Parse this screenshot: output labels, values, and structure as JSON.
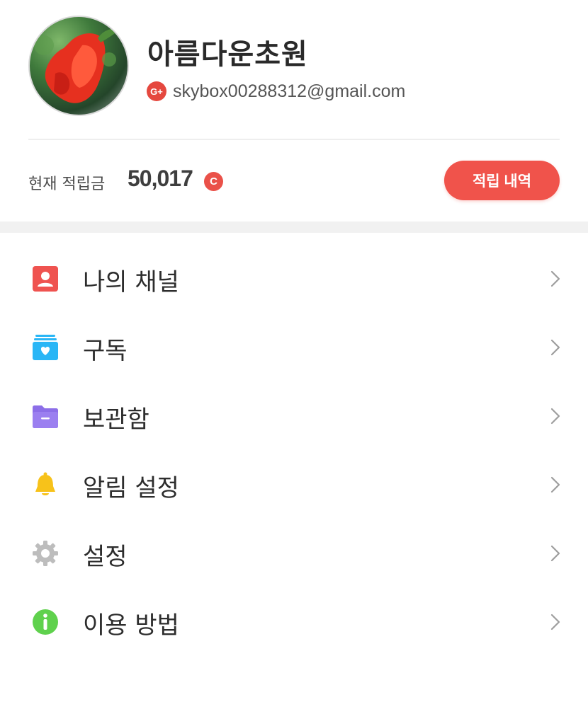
{
  "profile": {
    "name": "아름다운초원",
    "provider_badge": "G+",
    "email": "skybox00288312@gmail.com"
  },
  "points": {
    "label": "현재 적립금",
    "value": "50,017",
    "currency_badge": "C",
    "history_button": "적립 내역"
  },
  "menu": {
    "items": [
      {
        "label": "나의 채널",
        "icon": "person-badge-icon",
        "color": "#ef5350"
      },
      {
        "label": "구독",
        "icon": "subscription-stack-icon",
        "color": "#29b6f6"
      },
      {
        "label": "보관함",
        "icon": "folder-icon",
        "color": "#8c6ee8"
      },
      {
        "label": "알림 설정",
        "icon": "bell-icon",
        "color": "#f7c21a"
      },
      {
        "label": "설정",
        "icon": "gear-icon",
        "color": "#bdbdbd"
      },
      {
        "label": "이용 방법",
        "icon": "info-icon",
        "color": "#5fd14d"
      }
    ]
  },
  "colors": {
    "accent": "#f0534b",
    "text_dark": "#2b2b2b",
    "separator": "#f1f1f1"
  }
}
